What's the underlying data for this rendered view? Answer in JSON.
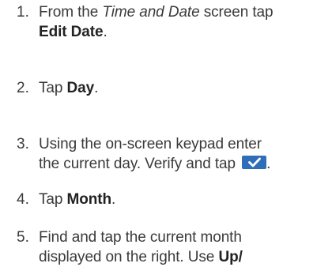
{
  "steps": [
    {
      "number": "1.",
      "line1_pre": "From the ",
      "line1_italic": "Time and Date",
      "line1_post": " screen tap",
      "line2_bold": "Edit Date",
      "line2_post": "."
    },
    {
      "number": "2.",
      "pre": "Tap ",
      "bold": "Day",
      "post": "."
    },
    {
      "number": "3.",
      "line1": "Using the on-screen keypad enter",
      "line2_pre": "the current day. Verify and tap ",
      "line2_icon": "checkmark-icon",
      "line2_post": "."
    },
    {
      "number": "4.",
      "pre": "Tap ",
      "bold": "Month",
      "post": "."
    },
    {
      "number": "5.",
      "line1": "Find and tap the current month",
      "line2_pre": "displayed on the right. Use ",
      "line2_bold": "Up/"
    }
  ],
  "colors": {
    "text": "#3a3a3a",
    "check_button": "#2f6fba"
  }
}
